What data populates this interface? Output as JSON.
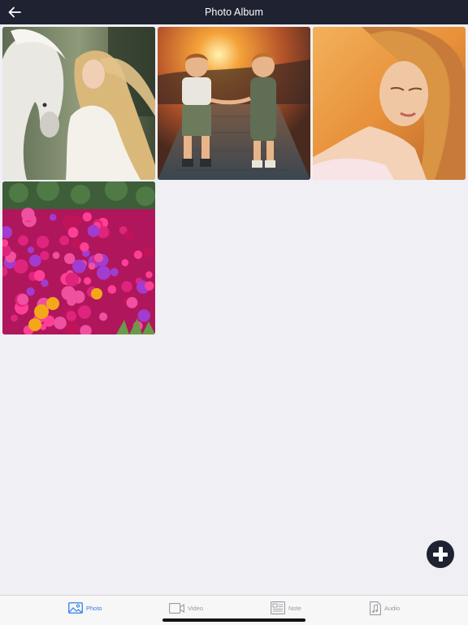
{
  "header": {
    "title": "Photo Album",
    "back_icon": "arrow-left-icon"
  },
  "photos": [
    {
      "subject": "woman with white horse"
    },
    {
      "subject": "two children holding hands at sunset"
    },
    {
      "subject": "portrait of woman in golden light"
    },
    {
      "subject": "magenta flower bed"
    }
  ],
  "fab": {
    "icon": "plus-icon"
  },
  "tabs": [
    {
      "label": "Photo",
      "icon": "photo-icon",
      "active": true
    },
    {
      "label": "Video",
      "icon": "video-icon",
      "active": false
    },
    {
      "label": "Note",
      "icon": "note-icon",
      "active": false
    },
    {
      "label": "Audio",
      "icon": "audio-icon",
      "active": false
    }
  ],
  "colors": {
    "navbar": "#1e2231",
    "background": "#efeff4",
    "active_tab": "#2f7fe6",
    "inactive_tab": "#9b9b9f"
  }
}
